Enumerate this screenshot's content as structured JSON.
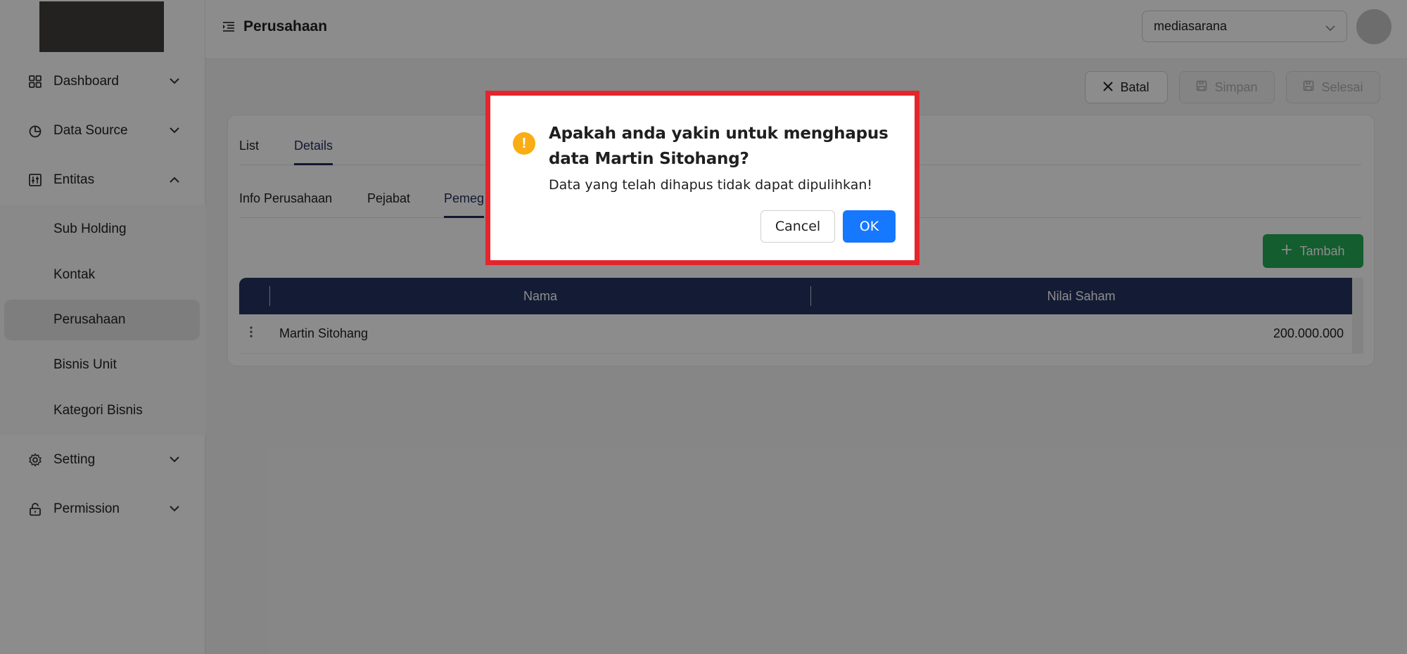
{
  "sidebar": {
    "items": [
      {
        "label": "Dashboard",
        "icon": "grid-icon"
      },
      {
        "label": "Data Source",
        "icon": "pie-chart-icon"
      },
      {
        "label": "Entitas",
        "icon": "sliders-icon"
      },
      {
        "label": "Setting",
        "icon": "gear-icon"
      },
      {
        "label": "Permission",
        "icon": "lock-icon"
      }
    ],
    "sub_items": [
      {
        "label": "Sub Holding"
      },
      {
        "label": "Kontak"
      },
      {
        "label": "Perusahaan"
      },
      {
        "label": "Bisnis Unit"
      },
      {
        "label": "Kategori Bisnis"
      }
    ]
  },
  "header": {
    "title": "Perusahaan",
    "select_value": "mediasarana"
  },
  "toolbar": {
    "cancel_label": "Batal",
    "save_label": "Simpan",
    "finish_label": "Selesai"
  },
  "tabs": [
    "List",
    "Details"
  ],
  "subtabs": [
    "Info Perusahaan",
    "Pejabat",
    "Pemeg"
  ],
  "add_label": "Tambah",
  "table": {
    "columns": [
      "Nama",
      "Nilai Saham"
    ],
    "rows": [
      {
        "nama": "Martin Sitohang",
        "nilai_saham": "200.000.000"
      }
    ]
  },
  "modal": {
    "title": "Apakah anda yakin untuk menghapus data Martin Sitohang?",
    "content": "Data yang telah dihapus tidak dapat dipulihkan!",
    "cancel_label": "Cancel",
    "ok_label": "OK",
    "icon_glyph": "!"
  },
  "colors": {
    "primary": "#1677ff",
    "table_header": "#263462",
    "success": "#23a955",
    "warning": "#faad14",
    "highlight": "#e4262c"
  }
}
